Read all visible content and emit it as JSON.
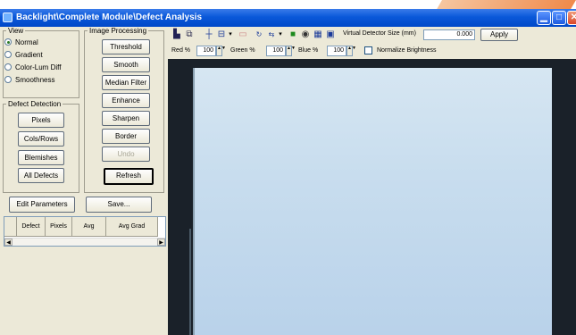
{
  "window": {
    "title": "Backlight\\Complete Module\\Defect Analysis"
  },
  "view": {
    "legend": "View",
    "options": [
      {
        "label": "Normal",
        "selected": true
      },
      {
        "label": "Gradient",
        "selected": false
      },
      {
        "label": "Color-Lum Diff",
        "selected": false
      },
      {
        "label": "Smoothness",
        "selected": false
      }
    ]
  },
  "defect_detection": {
    "legend": "Defect Detection",
    "buttons": [
      "Pixels",
      "Cols/Rows",
      "Blemishes",
      "All Defects"
    ]
  },
  "image_processing": {
    "legend": "Image Processing",
    "buttons": [
      "Threshold",
      "Smooth",
      "Median Filter",
      "Enhance",
      "Sharpen",
      "Border",
      "Undo"
    ]
  },
  "refresh_label": "Refresh",
  "edit_parameters_label": "Edit Parameters",
  "save_label": "Save...",
  "grid": {
    "columns": [
      "Defect",
      "Pixels",
      "Avg",
      "Avg Grad"
    ]
  },
  "toolbar": {
    "virtual_detector_label": "Virtual Detector Size (mm)",
    "virtual_detector_value": "0.000",
    "apply_label": "Apply",
    "red_label": "Red %",
    "red_value": "100",
    "green_label": "Green %",
    "green_value": "100",
    "blue_label": "Blue %",
    "blue_value": "100",
    "normalize_label": "Normalize Brightness",
    "icons": [
      "save-icon",
      "copy-icon",
      "crosshair-icon",
      "marker-icon",
      "region-icon",
      "rotate-icon",
      "flip-icon",
      "chart-icon",
      "camera-icon",
      "grid-icon",
      "export-icon"
    ]
  }
}
